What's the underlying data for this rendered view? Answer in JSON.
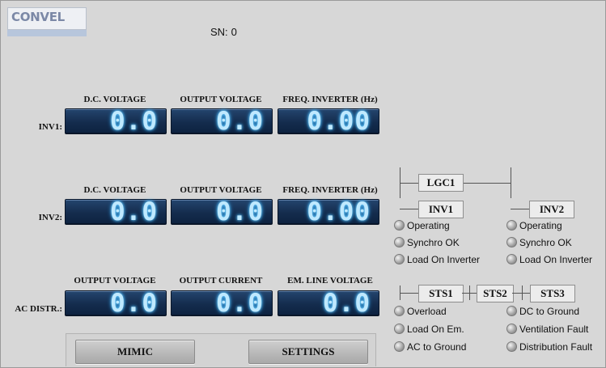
{
  "app": {
    "logo_text": "CONVEL"
  },
  "serial": {
    "label": "SN:",
    "value": "0"
  },
  "rows": [
    {
      "label": "INV1:",
      "cells": [
        {
          "header": "D.C. VOLTAGE",
          "value": "0.0"
        },
        {
          "header": "OUTPUT VOLTAGE",
          "value": "0.0"
        },
        {
          "header": "FREQ. INVERTER (Hz)",
          "value": "0.00"
        }
      ]
    },
    {
      "label": "INV2:",
      "cells": [
        {
          "header": "D.C. VOLTAGE",
          "value": "0.0"
        },
        {
          "header": "OUTPUT VOLTAGE",
          "value": "0.0"
        },
        {
          "header": "FREQ. INVERTER (Hz)",
          "value": "0.00"
        }
      ]
    },
    {
      "label": "AC DISTR.:",
      "cells": [
        {
          "header": "OUTPUT VOLTAGE",
          "value": "0.0"
        },
        {
          "header": "OUTPUT CURRENT",
          "value": "0.0"
        },
        {
          "header": "EM. LINE VOLTAGE",
          "value": "0.0"
        }
      ]
    }
  ],
  "buttons": {
    "mimic": "MIMIC",
    "settings": "SETTINGS"
  },
  "logic": {
    "lgc1": "LGC1",
    "inv1": {
      "title": "INV1",
      "items": [
        "Operating",
        "Synchro OK",
        "Load On Inverter"
      ]
    },
    "inv2": {
      "title": "INV2",
      "items": [
        "Operating",
        "Synchro OK",
        "Load On Inverter"
      ]
    },
    "sts1": {
      "title": "STS1",
      "items": [
        "Overload",
        "Load On Em.",
        "AC to Ground"
      ]
    },
    "sts2": {
      "title": "STS2"
    },
    "sts3": {
      "title": "STS3",
      "items": [
        "DC to Ground",
        "Ventilation Fault",
        "Distribution Fault"
      ]
    }
  },
  "colors": {
    "display_bg": "#142c4d",
    "display_text": "#bfe9ff",
    "panel_bg": "#d7d7d7"
  }
}
